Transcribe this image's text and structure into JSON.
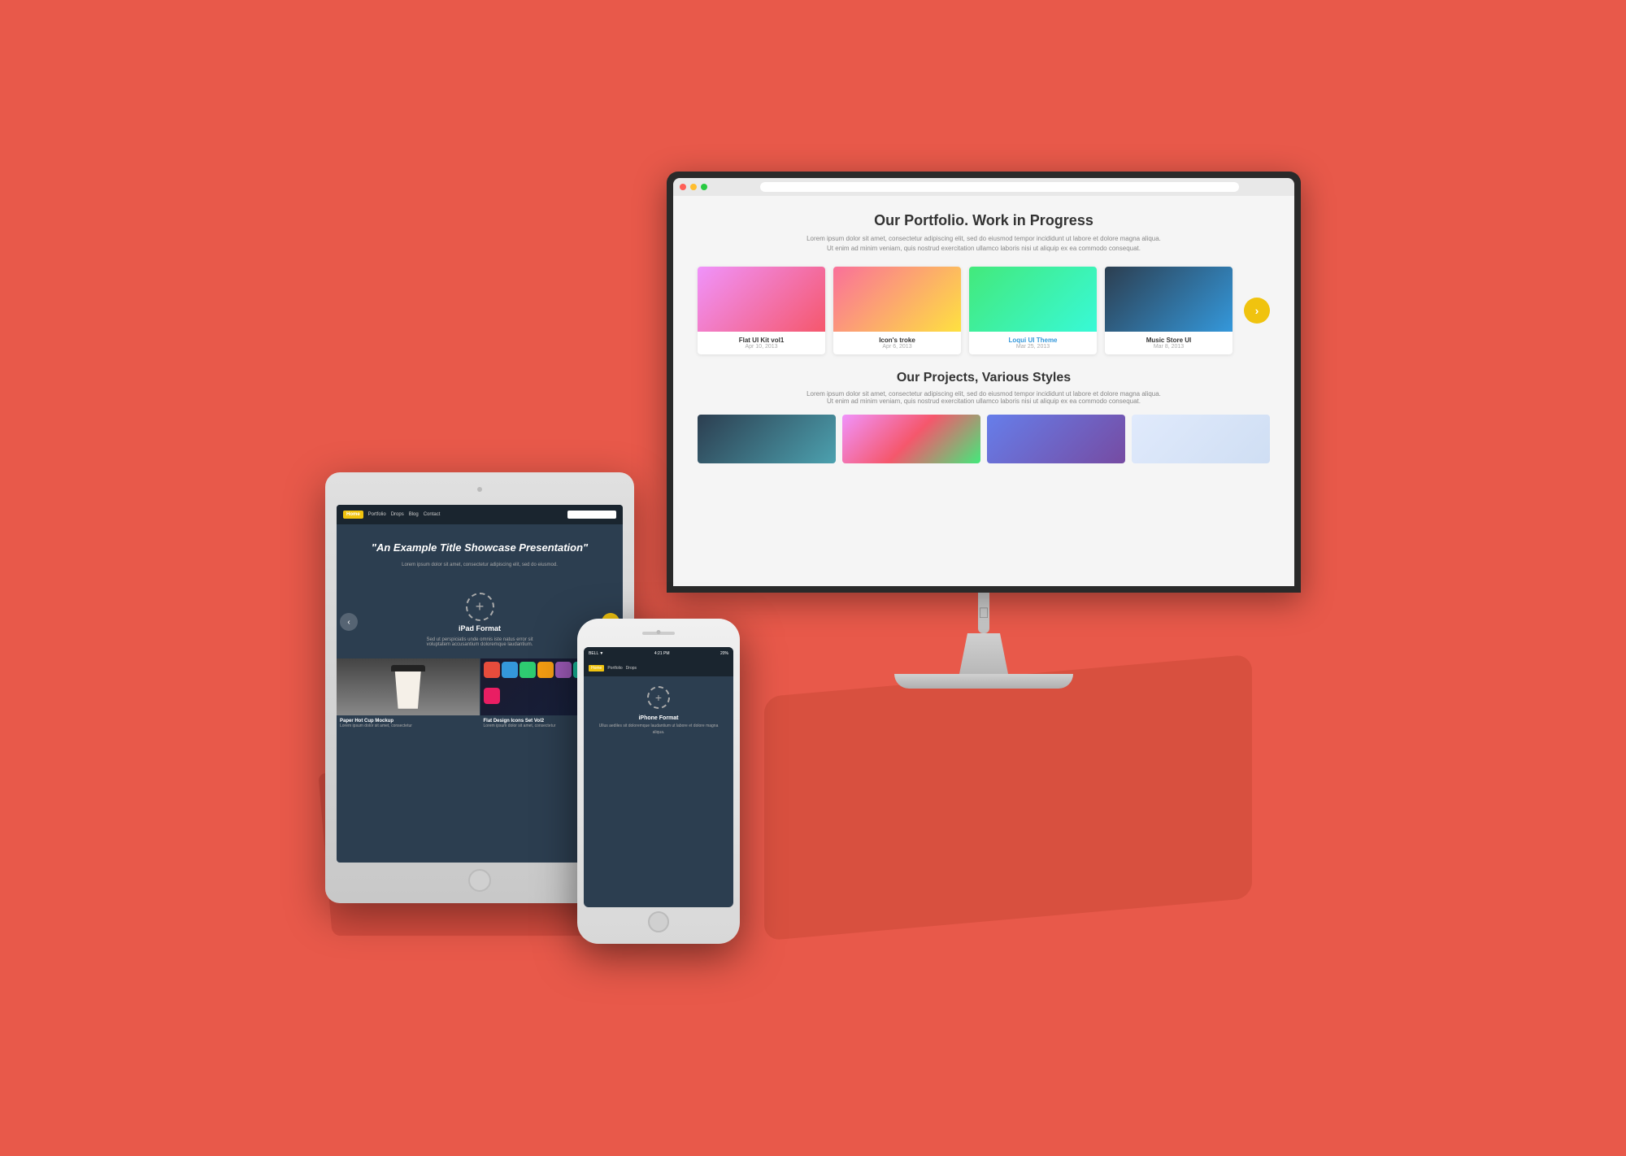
{
  "background_color": "#E8594A",
  "imac": {
    "portfolio_title": "Our Portfolio. Work in Progress",
    "portfolio_desc": "Lorem ipsum dolor sit amet, consectetur adipiscing elit, sed do eiusmod tempor incididunt ut labore et dolore magna aliqua.\nUt enim ad minim veniam, quis nostrud exercitation ullamco laboris nisi ut aliquip ex ea commodo consequat.",
    "portfolio_items": [
      {
        "name": "Flat UI Kit vol1",
        "date": "Apr 10, 2013",
        "color": "pink"
      },
      {
        "name": "Icon's troke",
        "date": "Apr 6, 2013",
        "color": "orange"
      },
      {
        "name": "Loqui UI Theme",
        "date": "Mar 25, 2013",
        "color": "teal",
        "highlight": true
      },
      {
        "name": "Music Store UI",
        "date": "Mar 8, 2013",
        "color": "dark"
      }
    ],
    "arrow_label": ">",
    "projects_title": "Our Projects, Various Styles",
    "projects_desc": "Lorem ipsum dolor sit amet, consectetur adipiscing elit, sed do eiusmod tempor incididunt ut labore et dolore magna aliqua.\nUt enim ad minim veniam, quis nostrud exercitation ullamco laboris nisi ut aliquip ex ea commodo consequat."
  },
  "ipad": {
    "hero_title": "\"An Example Title Showcase Presentation\"",
    "hero_desc": "Lorem ipsum dolor sit amet, consectetur adipiscing elit, sed do eiusmod.",
    "nav_items": [
      "Home",
      "Portfolio",
      "Drops",
      "Blog",
      "Contact"
    ],
    "card_title": "iPad Format",
    "card_desc": "Sed ut perspiciatis unde omnis iste natus error sit voluptatem accusantium doloremque laudantium.",
    "grid_items": [
      {
        "title": "Paper Hot Cup Mockup",
        "desc": "Lorem ipsum dolor sit amet, consectetur"
      },
      {
        "title": "Flat Design Icons Set Vol2",
        "desc": "Lorem ipsum dolor sit amet, consectetur"
      }
    ]
  },
  "iphone": {
    "status_time": "4:21 PM",
    "status_carrier": "BELL ▼",
    "status_battery": "20%",
    "nav_items": [
      "Home",
      "Portfolio",
      "Drops"
    ],
    "card_title": "iPhone Format",
    "card_desc": "Ullus aediles sit doloremque laudantium ut labore et dolore magna aliqua."
  },
  "detections": {
    "hot_cup_mockup": "Hot Cup Mockup",
    "format": "Format"
  }
}
